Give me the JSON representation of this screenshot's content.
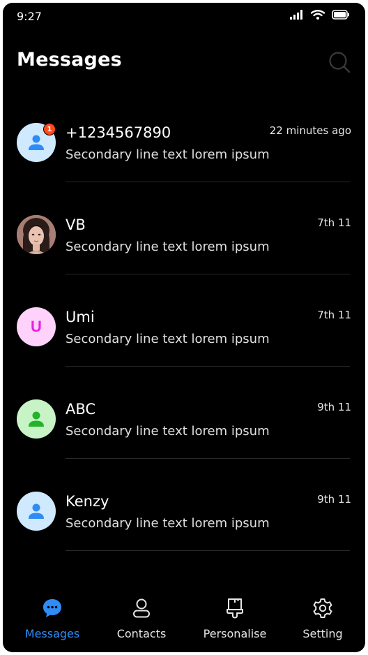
{
  "status_bar": {
    "time": "9:27"
  },
  "header": {
    "title": "Messages"
  },
  "messages": [
    {
      "name": "+1234567890",
      "preview": "Secondary line text lorem ipsum",
      "time": "22 minutes ago",
      "badge": "1",
      "avatar": "person-icon",
      "avatar_bg": "#cfe9ff",
      "avatar_fg": "#2f8cf5"
    },
    {
      "name": "VB",
      "preview": "Secondary line text lorem ipsum",
      "time": "7th 11",
      "avatar": "photo"
    },
    {
      "name": "Umi",
      "preview": "Secondary line text lorem ipsum",
      "time": "7th 11",
      "avatar_letter": "U",
      "avatar_bg": "#ffd2fb",
      "avatar_fg": "#e91ee0"
    },
    {
      "name": "ABC",
      "preview": "Secondary line text lorem ipsum",
      "time": "9th 11",
      "avatar": "person-icon",
      "avatar_bg": "#c7f3c6",
      "avatar_fg": "#22b32a"
    },
    {
      "name": "Kenzy",
      "preview": "Secondary line text lorem ipsum",
      "time": "9th 11",
      "avatar": "person-icon",
      "avatar_bg": "#cfe9ff",
      "avatar_fg": "#2f8cf5"
    }
  ],
  "nav": [
    {
      "label": "Messages",
      "icon": "chat-bubble-icon",
      "active": true
    },
    {
      "label": "Contacts",
      "icon": "contact-person-icon"
    },
    {
      "label": "Personalise",
      "icon": "brush-icon"
    },
    {
      "label": "Setting",
      "icon": "gear-icon"
    }
  ],
  "colors": {
    "accent": "#2f8cf5",
    "badge": "#ff4a1c",
    "background": "#000000"
  }
}
